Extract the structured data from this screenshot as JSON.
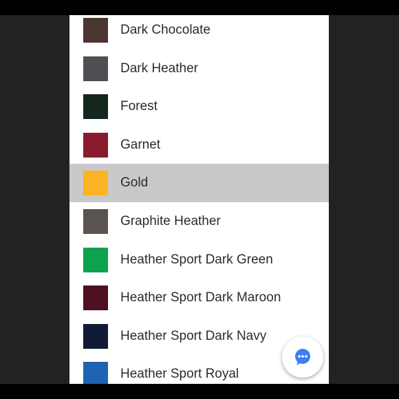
{
  "colors": {
    "selected_row_bg": "#c9c9c9",
    "sheet_bg": "#ffffff",
    "page_bg": "#222222",
    "chat_accent": "#3d7ff0"
  },
  "color_list": {
    "items": [
      {
        "label": "Dark Chocolate",
        "swatch": "#4b3631",
        "selected": false
      },
      {
        "label": "Dark Heather",
        "swatch": "#4f5056",
        "selected": false
      },
      {
        "label": "Forest",
        "swatch": "#13271d",
        "selected": false
      },
      {
        "label": "Garnet",
        "swatch": "#8a1a2e",
        "selected": false
      },
      {
        "label": "Gold",
        "swatch": "#fbb423",
        "selected": true
      },
      {
        "label": "Graphite Heather",
        "swatch": "#5b5350",
        "selected": false
      },
      {
        "label": "Heather Sport Dark Green",
        "swatch": "#0ea24f",
        "selected": false
      },
      {
        "label": "Heather Sport Dark Maroon",
        "swatch": "#4f101f",
        "selected": false
      },
      {
        "label": "Heather Sport Dark Navy",
        "swatch": "#121a35",
        "selected": false
      },
      {
        "label": "Heather Sport Royal",
        "swatch": "#1f63b1",
        "selected": false
      }
    ]
  },
  "chat_button": {
    "icon": "chat-bubble-icon"
  }
}
